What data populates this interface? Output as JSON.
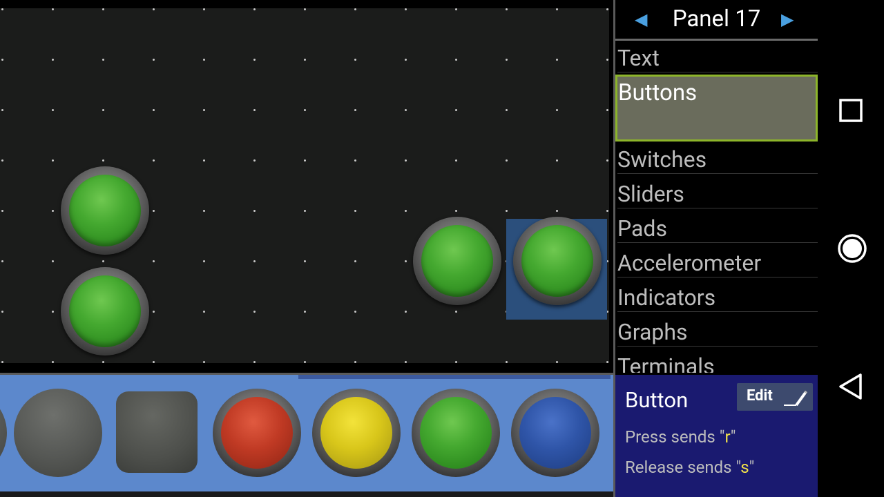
{
  "panel": {
    "prev": "◀",
    "title": "Panel 17",
    "next": "▶"
  },
  "categories": [
    {
      "label": "Text"
    },
    {
      "label": "Buttons",
      "selected": true
    },
    {
      "label": "Switches"
    },
    {
      "label": "Sliders"
    },
    {
      "label": "Pads"
    },
    {
      "label": "Accelerometer"
    },
    {
      "label": "Indicators"
    },
    {
      "label": "Graphs"
    },
    {
      "label": "Terminals"
    }
  ],
  "info": {
    "title": "Button",
    "edit_label": "Edit",
    "press_prefix": "Press sends \"",
    "press_value": "r",
    "press_suffix": "\"",
    "release_prefix": "Release sends \"",
    "release_value": "s",
    "release_suffix": "\""
  },
  "palette_colors": [
    "gray",
    "square",
    "red",
    "yellow",
    "green",
    "blue"
  ],
  "colors": {
    "accent": "#8db52a",
    "palette_bg": "#5c88cc",
    "info_bg": "#1a1a70",
    "highlight": "#f2e24a"
  },
  "nav_icons": [
    "recents-icon",
    "home-icon",
    "back-icon"
  ]
}
